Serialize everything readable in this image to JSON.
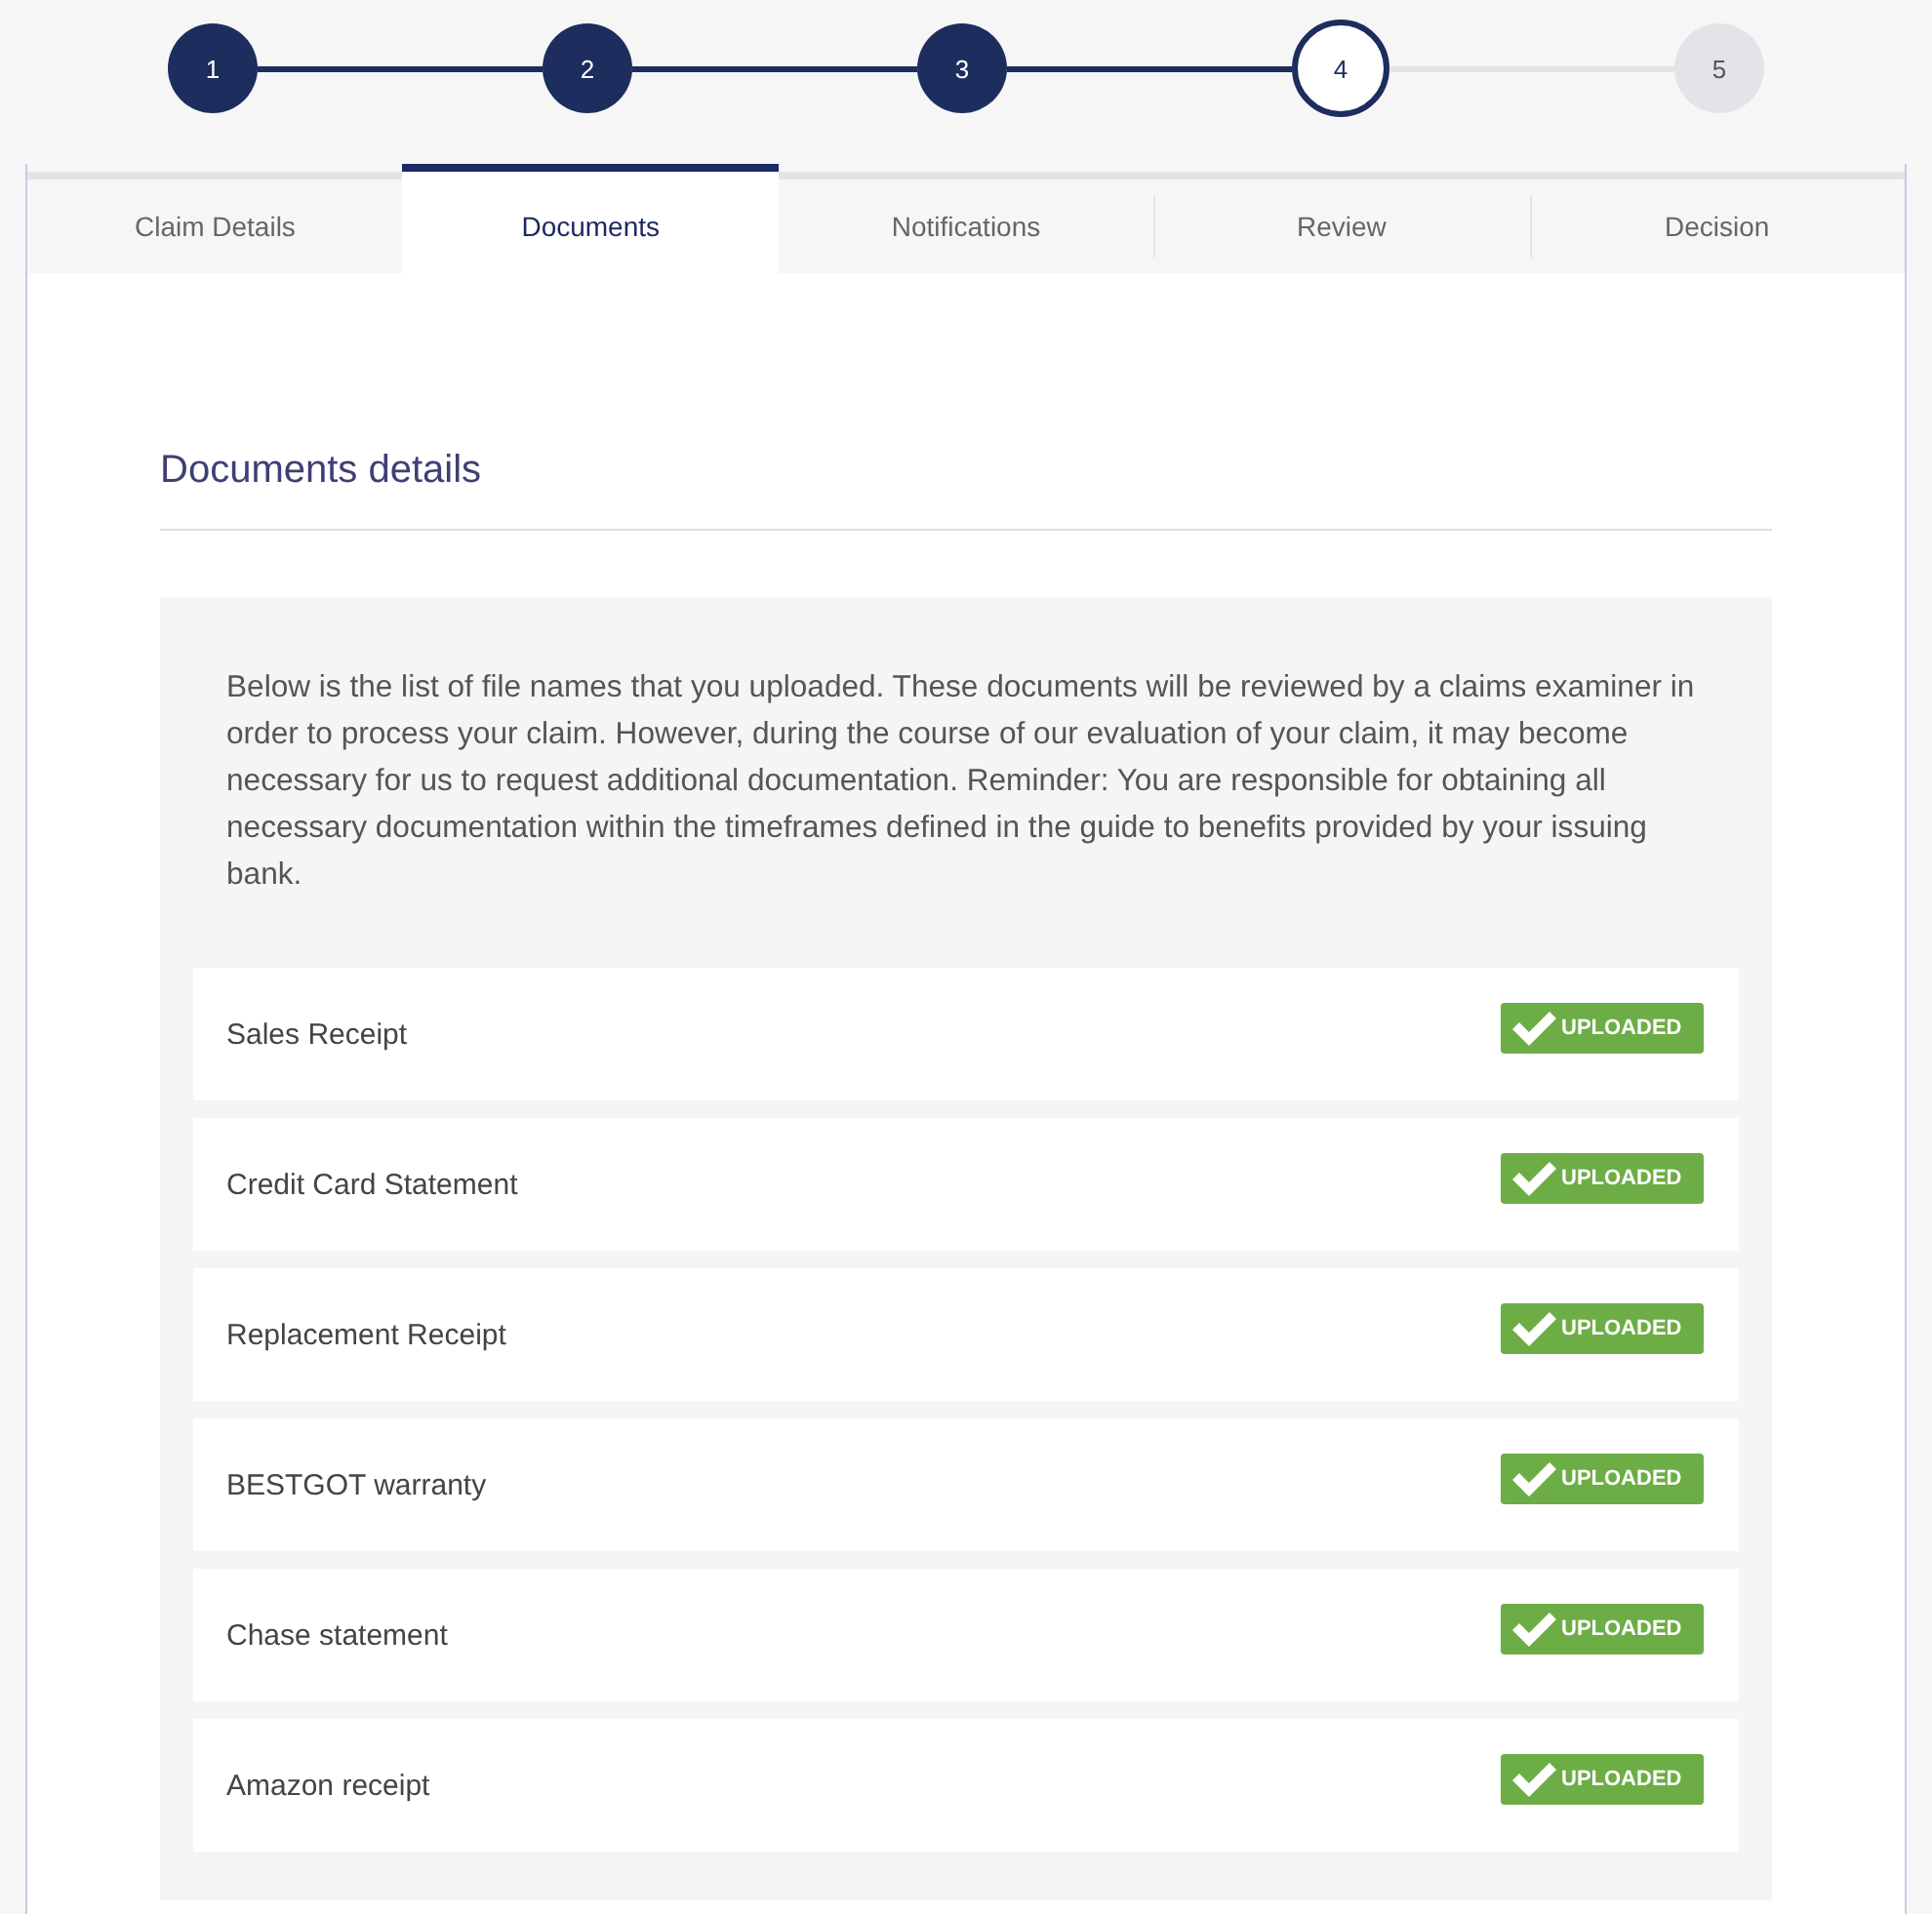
{
  "steps": [
    {
      "number": "1",
      "completed": true,
      "selected": false
    },
    {
      "number": "2",
      "completed": true,
      "selected": false
    },
    {
      "number": "3",
      "completed": true,
      "selected": false
    },
    {
      "number": "4",
      "completed": false,
      "selected": true
    },
    {
      "number": "5",
      "completed": false,
      "selected": false
    }
  ],
  "tabs": [
    {
      "label": "Claim Details",
      "selected": false
    },
    {
      "label": "Documents",
      "selected": true
    },
    {
      "label": "Notifications",
      "selected": false
    },
    {
      "label": "Review",
      "selected": false
    },
    {
      "label": "Decision",
      "selected": false
    }
  ],
  "section": {
    "title": "Documents details",
    "intro": "Below is the list of file names that you uploaded. These documents will be reviewed by a claims examiner in order to process your claim. However, during the course of our evaluation of your claim, it may become necessary for us to request additional documentation. Reminder: You are responsible for obtaining all necessary documentation within the timeframes defined in the guide to benefits provided by your issuing bank."
  },
  "documents": [
    {
      "name": "Sales Receipt",
      "status": "UPLOADED"
    },
    {
      "name": "Credit Card Statement",
      "status": "UPLOADED"
    },
    {
      "name": "Replacement Receipt",
      "status": "UPLOADED"
    },
    {
      "name": "BESTGOT warranty",
      "status": "UPLOADED"
    },
    {
      "name": "Chase statement",
      "status": "UPLOADED"
    },
    {
      "name": "Amazon receipt",
      "status": "UPLOADED"
    }
  ]
}
